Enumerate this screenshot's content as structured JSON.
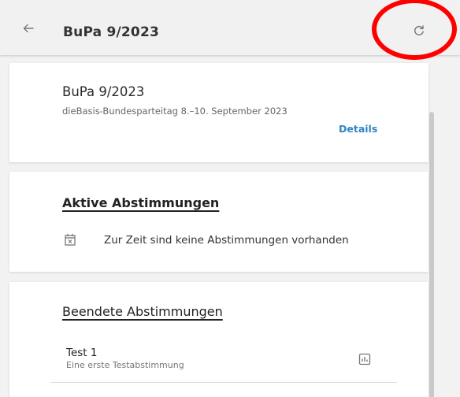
{
  "appbar": {
    "title": "BuPa 9/2023",
    "back_icon": "arrow-left-icon",
    "refresh_icon": "refresh-icon",
    "highlight_color": "#ff0000"
  },
  "event_card": {
    "title": "BuPa 9/2023",
    "subtitle": "dieBasis-Bundesparteitag 8.–10. September 2023",
    "details_label": "Details",
    "link_color": "#2f86c6"
  },
  "active_section": {
    "heading": "Aktive Abstimmungen",
    "empty_icon": "calendar-x-icon",
    "empty_text": "Zur Zeit sind keine Abstimmungen vorhanden"
  },
  "ended_section": {
    "heading": "Beendete Abstimmungen",
    "polls": [
      {
        "title": "Test 1",
        "description": "Eine erste Testabstimmung",
        "action_icon": "bar-chart-icon"
      }
    ]
  }
}
